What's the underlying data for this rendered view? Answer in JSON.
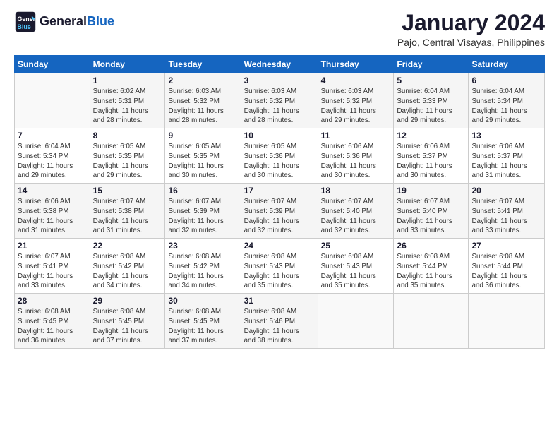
{
  "logo": {
    "line1": "General",
    "line2": "Blue"
  },
  "header": {
    "month": "January 2024",
    "location": "Pajo, Central Visayas, Philippines"
  },
  "weekdays": [
    "Sunday",
    "Monday",
    "Tuesday",
    "Wednesday",
    "Thursday",
    "Friday",
    "Saturday"
  ],
  "weeks": [
    [
      {
        "day": "",
        "info": ""
      },
      {
        "day": "1",
        "info": "Sunrise: 6:02 AM\nSunset: 5:31 PM\nDaylight: 11 hours\nand 28 minutes."
      },
      {
        "day": "2",
        "info": "Sunrise: 6:03 AM\nSunset: 5:32 PM\nDaylight: 11 hours\nand 28 minutes."
      },
      {
        "day": "3",
        "info": "Sunrise: 6:03 AM\nSunset: 5:32 PM\nDaylight: 11 hours\nand 28 minutes."
      },
      {
        "day": "4",
        "info": "Sunrise: 6:03 AM\nSunset: 5:32 PM\nDaylight: 11 hours\nand 29 minutes."
      },
      {
        "day": "5",
        "info": "Sunrise: 6:04 AM\nSunset: 5:33 PM\nDaylight: 11 hours\nand 29 minutes."
      },
      {
        "day": "6",
        "info": "Sunrise: 6:04 AM\nSunset: 5:34 PM\nDaylight: 11 hours\nand 29 minutes."
      }
    ],
    [
      {
        "day": "7",
        "info": "Sunrise: 6:04 AM\nSunset: 5:34 PM\nDaylight: 11 hours\nand 29 minutes."
      },
      {
        "day": "8",
        "info": "Sunrise: 6:05 AM\nSunset: 5:35 PM\nDaylight: 11 hours\nand 29 minutes."
      },
      {
        "day": "9",
        "info": "Sunrise: 6:05 AM\nSunset: 5:35 PM\nDaylight: 11 hours\nand 30 minutes."
      },
      {
        "day": "10",
        "info": "Sunrise: 6:05 AM\nSunset: 5:36 PM\nDaylight: 11 hours\nand 30 minutes."
      },
      {
        "day": "11",
        "info": "Sunrise: 6:06 AM\nSunset: 5:36 PM\nDaylight: 11 hours\nand 30 minutes."
      },
      {
        "day": "12",
        "info": "Sunrise: 6:06 AM\nSunset: 5:37 PM\nDaylight: 11 hours\nand 30 minutes."
      },
      {
        "day": "13",
        "info": "Sunrise: 6:06 AM\nSunset: 5:37 PM\nDaylight: 11 hours\nand 31 minutes."
      }
    ],
    [
      {
        "day": "14",
        "info": "Sunrise: 6:06 AM\nSunset: 5:38 PM\nDaylight: 11 hours\nand 31 minutes."
      },
      {
        "day": "15",
        "info": "Sunrise: 6:07 AM\nSunset: 5:38 PM\nDaylight: 11 hours\nand 31 minutes."
      },
      {
        "day": "16",
        "info": "Sunrise: 6:07 AM\nSunset: 5:39 PM\nDaylight: 11 hours\nand 32 minutes."
      },
      {
        "day": "17",
        "info": "Sunrise: 6:07 AM\nSunset: 5:39 PM\nDaylight: 11 hours\nand 32 minutes."
      },
      {
        "day": "18",
        "info": "Sunrise: 6:07 AM\nSunset: 5:40 PM\nDaylight: 11 hours\nand 32 minutes."
      },
      {
        "day": "19",
        "info": "Sunrise: 6:07 AM\nSunset: 5:40 PM\nDaylight: 11 hours\nand 33 minutes."
      },
      {
        "day": "20",
        "info": "Sunrise: 6:07 AM\nSunset: 5:41 PM\nDaylight: 11 hours\nand 33 minutes."
      }
    ],
    [
      {
        "day": "21",
        "info": "Sunrise: 6:07 AM\nSunset: 5:41 PM\nDaylight: 11 hours\nand 33 minutes."
      },
      {
        "day": "22",
        "info": "Sunrise: 6:08 AM\nSunset: 5:42 PM\nDaylight: 11 hours\nand 34 minutes."
      },
      {
        "day": "23",
        "info": "Sunrise: 6:08 AM\nSunset: 5:42 PM\nDaylight: 11 hours\nand 34 minutes."
      },
      {
        "day": "24",
        "info": "Sunrise: 6:08 AM\nSunset: 5:43 PM\nDaylight: 11 hours\nand 35 minutes."
      },
      {
        "day": "25",
        "info": "Sunrise: 6:08 AM\nSunset: 5:43 PM\nDaylight: 11 hours\nand 35 minutes."
      },
      {
        "day": "26",
        "info": "Sunrise: 6:08 AM\nSunset: 5:44 PM\nDaylight: 11 hours\nand 35 minutes."
      },
      {
        "day": "27",
        "info": "Sunrise: 6:08 AM\nSunset: 5:44 PM\nDaylight: 11 hours\nand 36 minutes."
      }
    ],
    [
      {
        "day": "28",
        "info": "Sunrise: 6:08 AM\nSunset: 5:45 PM\nDaylight: 11 hours\nand 36 minutes."
      },
      {
        "day": "29",
        "info": "Sunrise: 6:08 AM\nSunset: 5:45 PM\nDaylight: 11 hours\nand 37 minutes."
      },
      {
        "day": "30",
        "info": "Sunrise: 6:08 AM\nSunset: 5:45 PM\nDaylight: 11 hours\nand 37 minutes."
      },
      {
        "day": "31",
        "info": "Sunrise: 6:08 AM\nSunset: 5:46 PM\nDaylight: 11 hours\nand 38 minutes."
      },
      {
        "day": "",
        "info": ""
      },
      {
        "day": "",
        "info": ""
      },
      {
        "day": "",
        "info": ""
      }
    ]
  ]
}
